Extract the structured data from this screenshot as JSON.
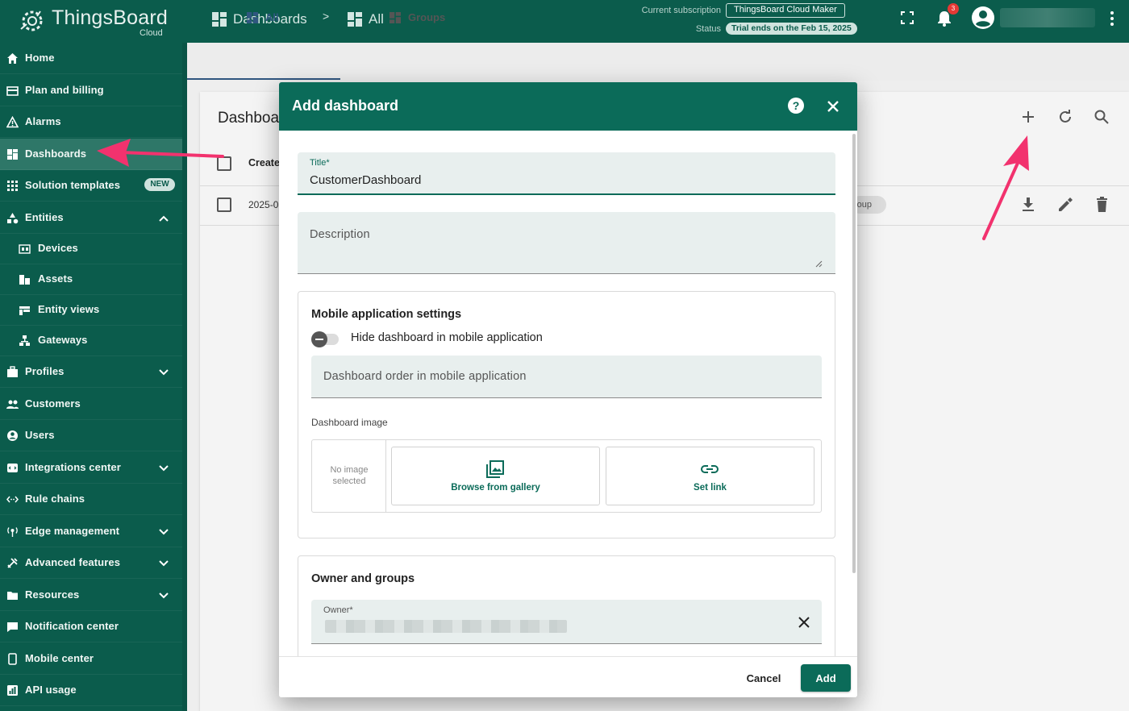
{
  "app": {
    "logo_text": "ThingsBoard",
    "logo_sub": "Cloud"
  },
  "topbar": {
    "breadcrumb": [
      "Dashboards",
      ">",
      "All"
    ],
    "subscription_label": "Current subscription",
    "subscription_value": "ThingsBoard Cloud Maker",
    "status_label": "Status",
    "status_value": "Trial ends on the Feb 15, 2025",
    "notification_count": "3",
    "icons": [
      "fullscreen-icon",
      "notifications-icon",
      "account-icon",
      "more-vert-icon"
    ]
  },
  "sidebar": {
    "items": [
      {
        "label": "Home",
        "icon": "home-icon"
      },
      {
        "label": "Plan and billing",
        "icon": "billing-icon"
      },
      {
        "label": "Alarms",
        "icon": "alarm-icon"
      },
      {
        "label": "Dashboards",
        "icon": "dashboard-icon",
        "active": true
      },
      {
        "label": "Solution templates",
        "icon": "apps-icon",
        "badge": "NEW"
      },
      {
        "label": "Entities",
        "icon": "entities-icon",
        "expanded": true
      },
      {
        "label": "Devices",
        "icon": "devices-icon",
        "sub": true
      },
      {
        "label": "Assets",
        "icon": "assets-icon",
        "sub": true
      },
      {
        "label": "Entity views",
        "icon": "entity-views-icon",
        "sub": true
      },
      {
        "label": "Gateways",
        "icon": "gateways-icon",
        "sub": true
      },
      {
        "label": "Profiles",
        "icon": "profiles-icon",
        "expandable": true
      },
      {
        "label": "Customers",
        "icon": "customers-icon"
      },
      {
        "label": "Users",
        "icon": "users-icon"
      },
      {
        "label": "Integrations center",
        "icon": "integrations-icon",
        "expandable": true
      },
      {
        "label": "Rule chains",
        "icon": "rule-chains-icon"
      },
      {
        "label": "Edge management",
        "icon": "edge-icon",
        "expandable": true
      },
      {
        "label": "Advanced features",
        "icon": "advanced-icon",
        "expandable": true
      },
      {
        "label": "Resources",
        "icon": "resources-icon",
        "expandable": true
      },
      {
        "label": "Notification center",
        "icon": "notification-center-icon"
      },
      {
        "label": "Mobile center",
        "icon": "mobile-icon"
      },
      {
        "label": "API usage",
        "icon": "api-usage-icon"
      }
    ]
  },
  "main": {
    "tabs": [
      {
        "label": "All"
      },
      {
        "label": "Groups"
      }
    ],
    "card_title": "Dashboa",
    "column_header": "Create",
    "row_date": "2025-0",
    "row_chip": "roup",
    "actions": [
      "add-icon",
      "refresh-icon",
      "search-icon"
    ],
    "row_actions": [
      "download-icon",
      "edit-icon",
      "delete-icon"
    ]
  },
  "dialog": {
    "title": "Add dashboard",
    "title_field": {
      "label": "Title*",
      "value": "CustomerDashboard"
    },
    "description_field": {
      "placeholder": "Description"
    },
    "mobile_section": {
      "title": "Mobile application settings",
      "toggle_label": "Hide dashboard in mobile application",
      "toggle_on": false,
      "order_placeholder": "Dashboard order in mobile application",
      "image_label": "Dashboard image",
      "no_image": "No image selected",
      "browse_label": "Browse from gallery",
      "link_label": "Set link"
    },
    "owner_section": {
      "title": "Owner and groups",
      "owner_label": "Owner*"
    },
    "cancel_label": "Cancel",
    "add_label": "Add"
  },
  "colors": {
    "primary": "#0b5c4c",
    "dialog_header": "#0b6b59",
    "annotation_arrow": "#f2326e"
  }
}
